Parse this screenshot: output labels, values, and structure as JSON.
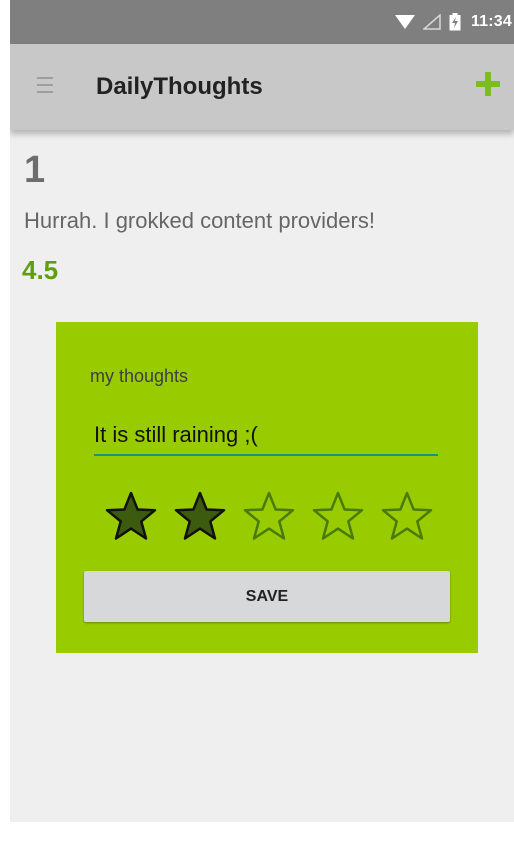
{
  "status_bar": {
    "time": "11:34",
    "icons": [
      "wifi-icon",
      "cell-signal-icon",
      "battery-charging-icon"
    ]
  },
  "app_bar": {
    "title": "DailyThoughts",
    "menu_icon": "menu-icon",
    "add_icon": "add-icon",
    "accent_color": "#7bbd1f"
  },
  "entry": {
    "number": "1",
    "text": "Hurrah. I grokked content providers!",
    "rating": "4.5"
  },
  "dialog": {
    "label": "my thoughts",
    "input_value": "It is still raining ;(",
    "rating": {
      "filled": 2,
      "total": 5
    },
    "save_label": "SAVE",
    "background_color": "#99cc00"
  }
}
